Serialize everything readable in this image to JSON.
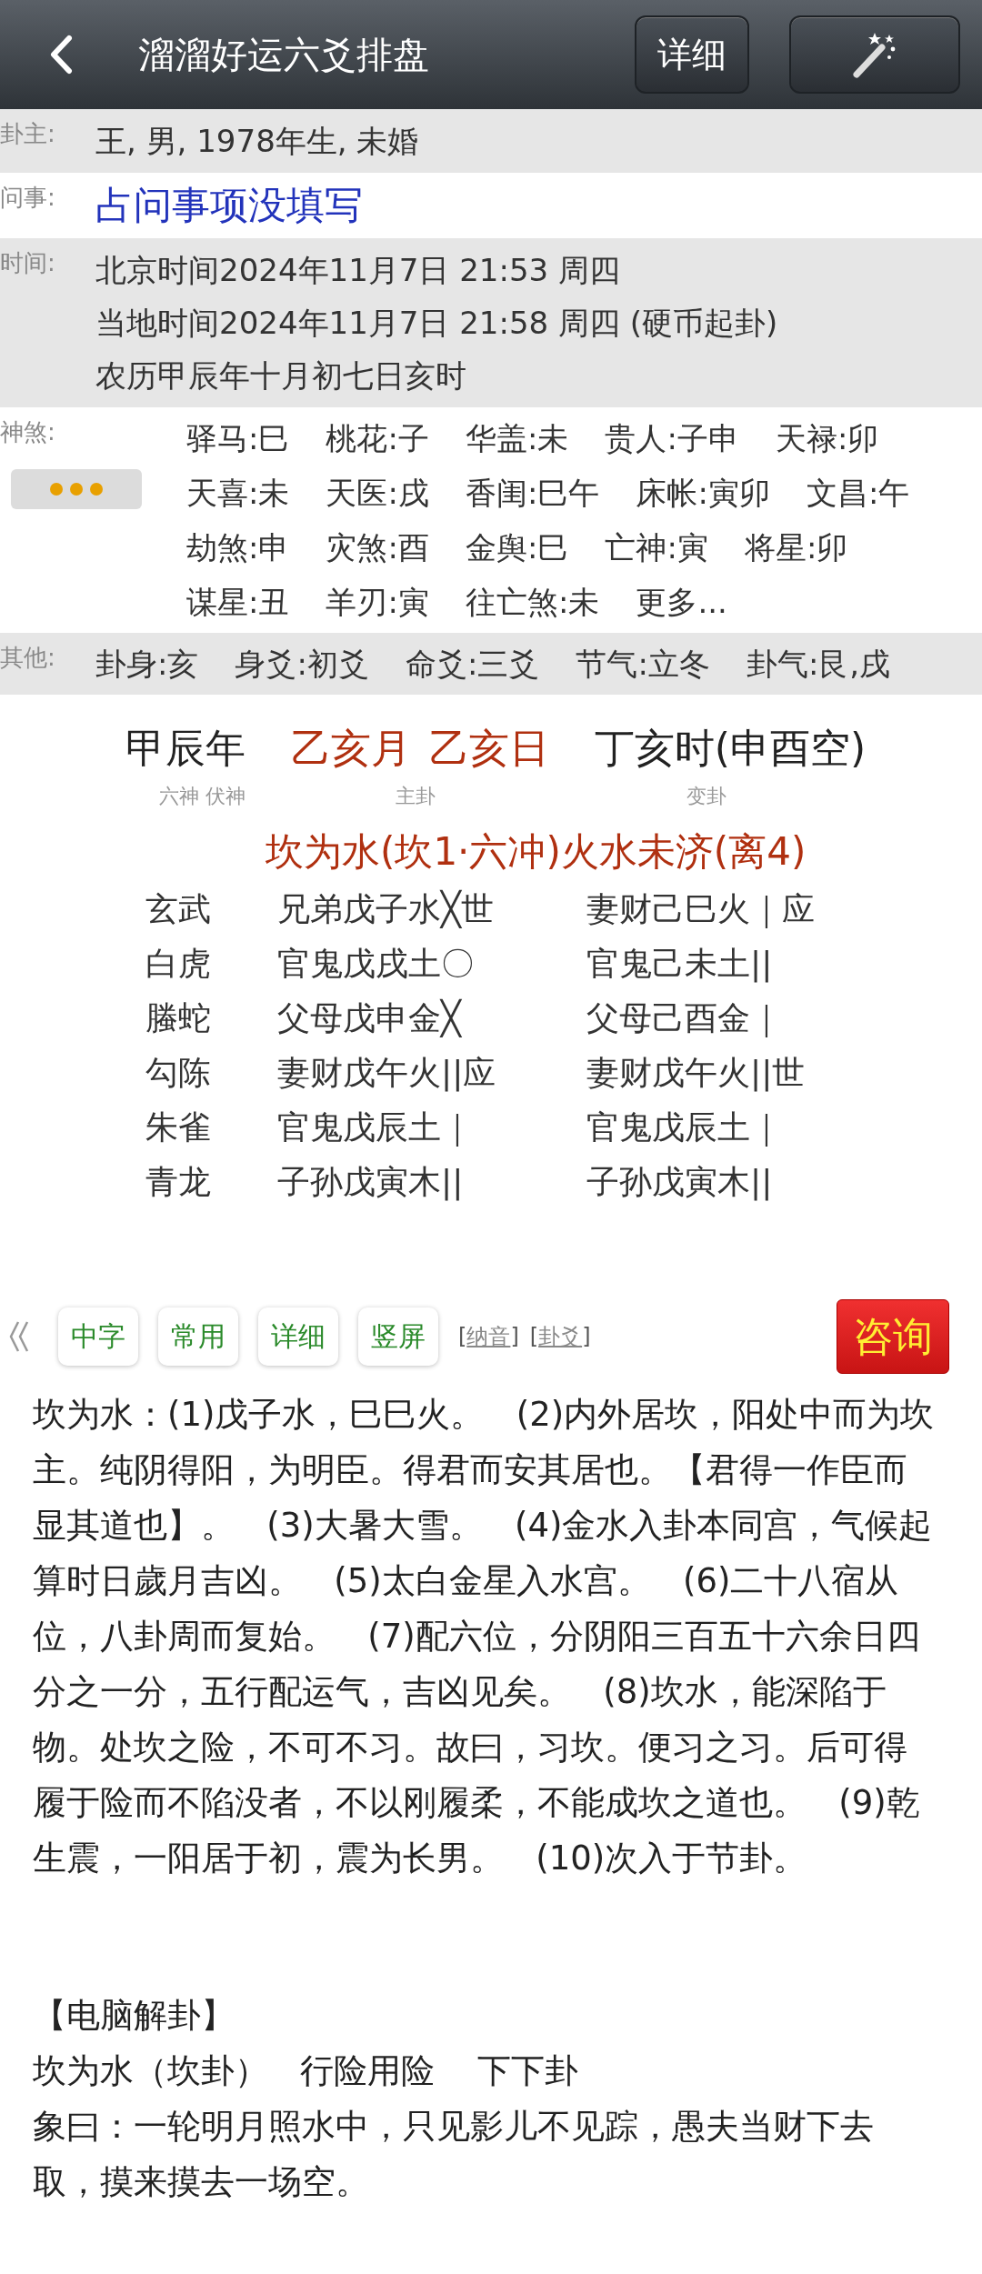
{
  "header": {
    "title": "溜溜好运六爻排盘",
    "detail_button": "详细"
  },
  "info_rows": [
    {
      "label": "卦主:",
      "kind": "plain",
      "lines": [
        "王, 男, 1978年生, 未婚"
      ]
    },
    {
      "label": "问事:",
      "kind": "question",
      "lines": [
        "占问事项没填写"
      ]
    },
    {
      "label": "时间:",
      "kind": "plain",
      "lines": [
        "北京时间2024年11月7日 21:53 周四",
        "当地时间2024年11月7日 21:58 周四 (硬币起卦)",
        "农历甲辰年十月初七日亥时"
      ]
    },
    {
      "label": "神煞:",
      "kind": "tags",
      "items": [
        "驿马:巳",
        "桃花:子",
        "华盖:未",
        "贵人:子申",
        "天禄:卯",
        "天喜:未",
        "天医:戌",
        "香闺:巳午",
        "床帐:寅卯",
        "文昌:午",
        "劫煞:申",
        "灾煞:酉",
        "金舆:巳",
        "亡神:寅",
        "将星:卯",
        "谋星:丑",
        "羊刃:寅",
        "往亡煞:未",
        "更多..."
      ]
    },
    {
      "label": "其他:",
      "kind": "tags",
      "items": [
        "卦身:亥",
        "身爻:初爻",
        "命爻:三爻",
        "节气:立冬",
        "卦气:艮,戌"
      ]
    }
  ],
  "chart": {
    "pillars": [
      {
        "text": "甲辰年",
        "highlight": false
      },
      {
        "text": "乙亥月",
        "highlight": true
      },
      {
        "text": "乙亥日",
        "highlight": true
      },
      {
        "text": "丁亥时(申酉空)",
        "highlight": false
      }
    ],
    "subheads": [
      "六神  伏神",
      "主卦",
      "变卦"
    ],
    "gua_name": "坎为水(坎1·六冲)火水未济(离4)",
    "lines": [
      {
        "spirit": "玄武",
        "main": "兄弟戊子水╳世",
        "changed": "妻财己巳火｜应"
      },
      {
        "spirit": "白虎",
        "main": "官鬼戊戌土〇",
        "changed": "官鬼己未土||"
      },
      {
        "spirit": "螣蛇",
        "main": "父母戊申金╳",
        "changed": "父母己酉金｜"
      },
      {
        "spirit": "勾陈",
        "main": "妻财戊午火||应",
        "changed": "妻财戊午火||世"
      },
      {
        "spirit": "朱雀",
        "main": "官鬼戊辰土｜",
        "changed": "官鬼戊辰土｜"
      },
      {
        "spirit": "青龙",
        "main": "子孙戊寅木||",
        "changed": "子孙戊寅木||"
      }
    ]
  },
  "toolbar": {
    "buttons": [
      "中字",
      "常用",
      "详细",
      "竖屏"
    ],
    "links": [
      {
        "before": "[",
        "label": "纳音",
        "after": "]"
      },
      {
        "before": "[",
        "label": "卦爻",
        "after": "]"
      }
    ],
    "consult": "咨询"
  },
  "body": [
    {
      "kind": "para",
      "text": "坎为水：(1)戊子水，巳巳火。   (2)内外居坎，阳处中而为坎主。纯阴得阳，为明臣。得君而安其居也。【君得一作臣而显其道也】。   (3)大暑大雪。   (4)金水入卦本同宫，气候起算时日歲月吉凶。   (5)太白金星入水宫。   (6)二十八宿从位，八卦周而复始。   (7)配六位，分阴阳三百五十六余日四分之一分，五行配运气，吉凶见矣。   (8)坎水，能深陷于物。处坎之险，不可不习。故曰，习坎。便习之习。后可得履于险而不陷没者，不以刚履柔，不能成坎之道也。   (9)乾生震，一阳居于初，震为长男。   (10)次入于节卦。"
    },
    {
      "kind": "gap"
    },
    {
      "kind": "heading",
      "text": "【电脑解卦】"
    },
    {
      "kind": "para",
      "text": "坎为水（坎卦）   行险用险    下下卦"
    },
    {
      "kind": "para",
      "text": "象曰：一轮明月照水中，只见影儿不见踪，愚夫当财下去取，摸来摸去一场空。"
    }
  ]
}
